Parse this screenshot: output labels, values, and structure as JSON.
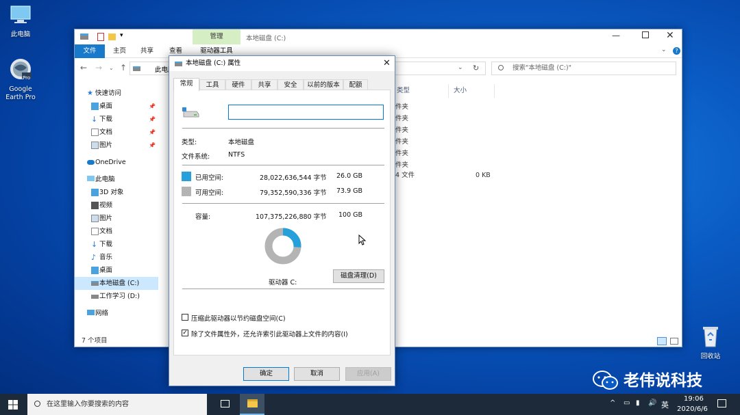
{
  "desktop": {
    "icons": [
      {
        "label": "此电脑",
        "icon": "this-pc-icon"
      },
      {
        "label": "Google Earth Pro",
        "line1": "Google",
        "line2": "Earth Pro",
        "badge": "Pro",
        "icon": "google-earth-icon"
      },
      {
        "label": "回收站",
        "icon": "recycle-bin-icon"
      }
    ],
    "watermark": "老伟说科技"
  },
  "explorer": {
    "context_tab_group": "管理",
    "context_tab": "驱动器工具",
    "ribbon_tabs": [
      "文件",
      "主页",
      "共享",
      "查看"
    ],
    "drive_title": "本地磁盘 (C:)",
    "address_partial": "此电脑",
    "search_placeholder": "搜索\"本地磁盘 (C:)\"",
    "col_type": "类型",
    "col_size": "大小",
    "file_rows": [
      {
        "type": "件夹",
        "size": ""
      },
      {
        "type": "件夹",
        "size": ""
      },
      {
        "type": "件夹",
        "size": ""
      },
      {
        "type": "件夹",
        "size": ""
      },
      {
        "type": "件夹",
        "size": ""
      },
      {
        "type": "件夹",
        "size": ""
      },
      {
        "type": "4 文件",
        "size": "0 KB"
      }
    ],
    "nav": {
      "quick_access": "快速访问",
      "desktop": "桌面",
      "downloads": "下载",
      "documents": "文档",
      "pictures": "图片",
      "onedrive": "OneDrive",
      "this_pc": "此电脑",
      "objects3d": "3D 对象",
      "videos": "视频",
      "pictures2": "图片",
      "documents2": "文档",
      "downloads2": "下载",
      "music": "音乐",
      "desktop2": "桌面",
      "drive_c": "本地磁盘 (C:)",
      "drive_d": "工作学习 (D:)",
      "network": "网络"
    },
    "status": "7 个项目"
  },
  "dialog": {
    "title": "本地磁盘 (C:) 属性",
    "tabs": [
      "常规",
      "工具",
      "硬件",
      "共享",
      "安全",
      "以前的版本",
      "配额"
    ],
    "name_value": "",
    "type_label": "类型:",
    "type_value": "本地磁盘",
    "fs_label": "文件系统:",
    "fs_value": "NTFS",
    "used_label": "已用空间:",
    "used_bytes": "28,022,636,544 字节",
    "used_gb": "26.0 GB",
    "free_label": "可用空间:",
    "free_bytes": "79,352,590,336 字节",
    "free_gb": "73.9 GB",
    "cap_label": "容量:",
    "cap_bytes": "107,375,226,880 字节",
    "cap_gb": "100 GB",
    "drive_label": "驱动器 C:",
    "cleanup_button": "磁盘清理(D)",
    "compress_label": "压缩此驱动器以节约磁盘空间(C)",
    "compress_checked": false,
    "index_label": "除了文件属性外，还允许索引此驱动器上文件的内容(I)",
    "index_checked": true,
    "ok": "确定",
    "cancel": "取消",
    "apply": "应用(A)",
    "used_fraction": 0.261,
    "colors": {
      "used": "#26a0da",
      "free": "#b4b4b4"
    }
  },
  "taskbar": {
    "search_placeholder": "在这里输入你要搜索的内容",
    "ime": "英",
    "time": "19:06",
    "date": "2020/6/6"
  }
}
